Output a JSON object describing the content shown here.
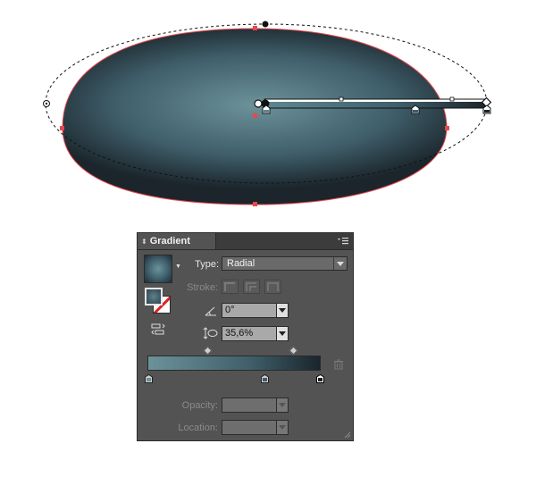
{
  "panel": {
    "tab_label": "Gradient",
    "type_label": "Type:",
    "type_value": "Radial",
    "stroke_label": "Stroke:",
    "angle_value": "0°",
    "aspect_value": "35,6%",
    "opacity_label": "Opacity:",
    "location_label": "Location:"
  },
  "colors": {
    "gradient_start": "#6c929a",
    "gradient_mid": "#3f5e6a",
    "gradient_end": "#1b252b",
    "selection_red": "#e8474e",
    "panel_bg": "#535353"
  },
  "icons": {
    "tab_arrows": "up-down-arrows",
    "panel_menu": "panel-menu-icon",
    "angle": "angle-icon",
    "aspect_ratio": "aspect-ratio-icon",
    "reverse": "reverse-gradient-icon",
    "delete_stop": "trash-icon"
  }
}
